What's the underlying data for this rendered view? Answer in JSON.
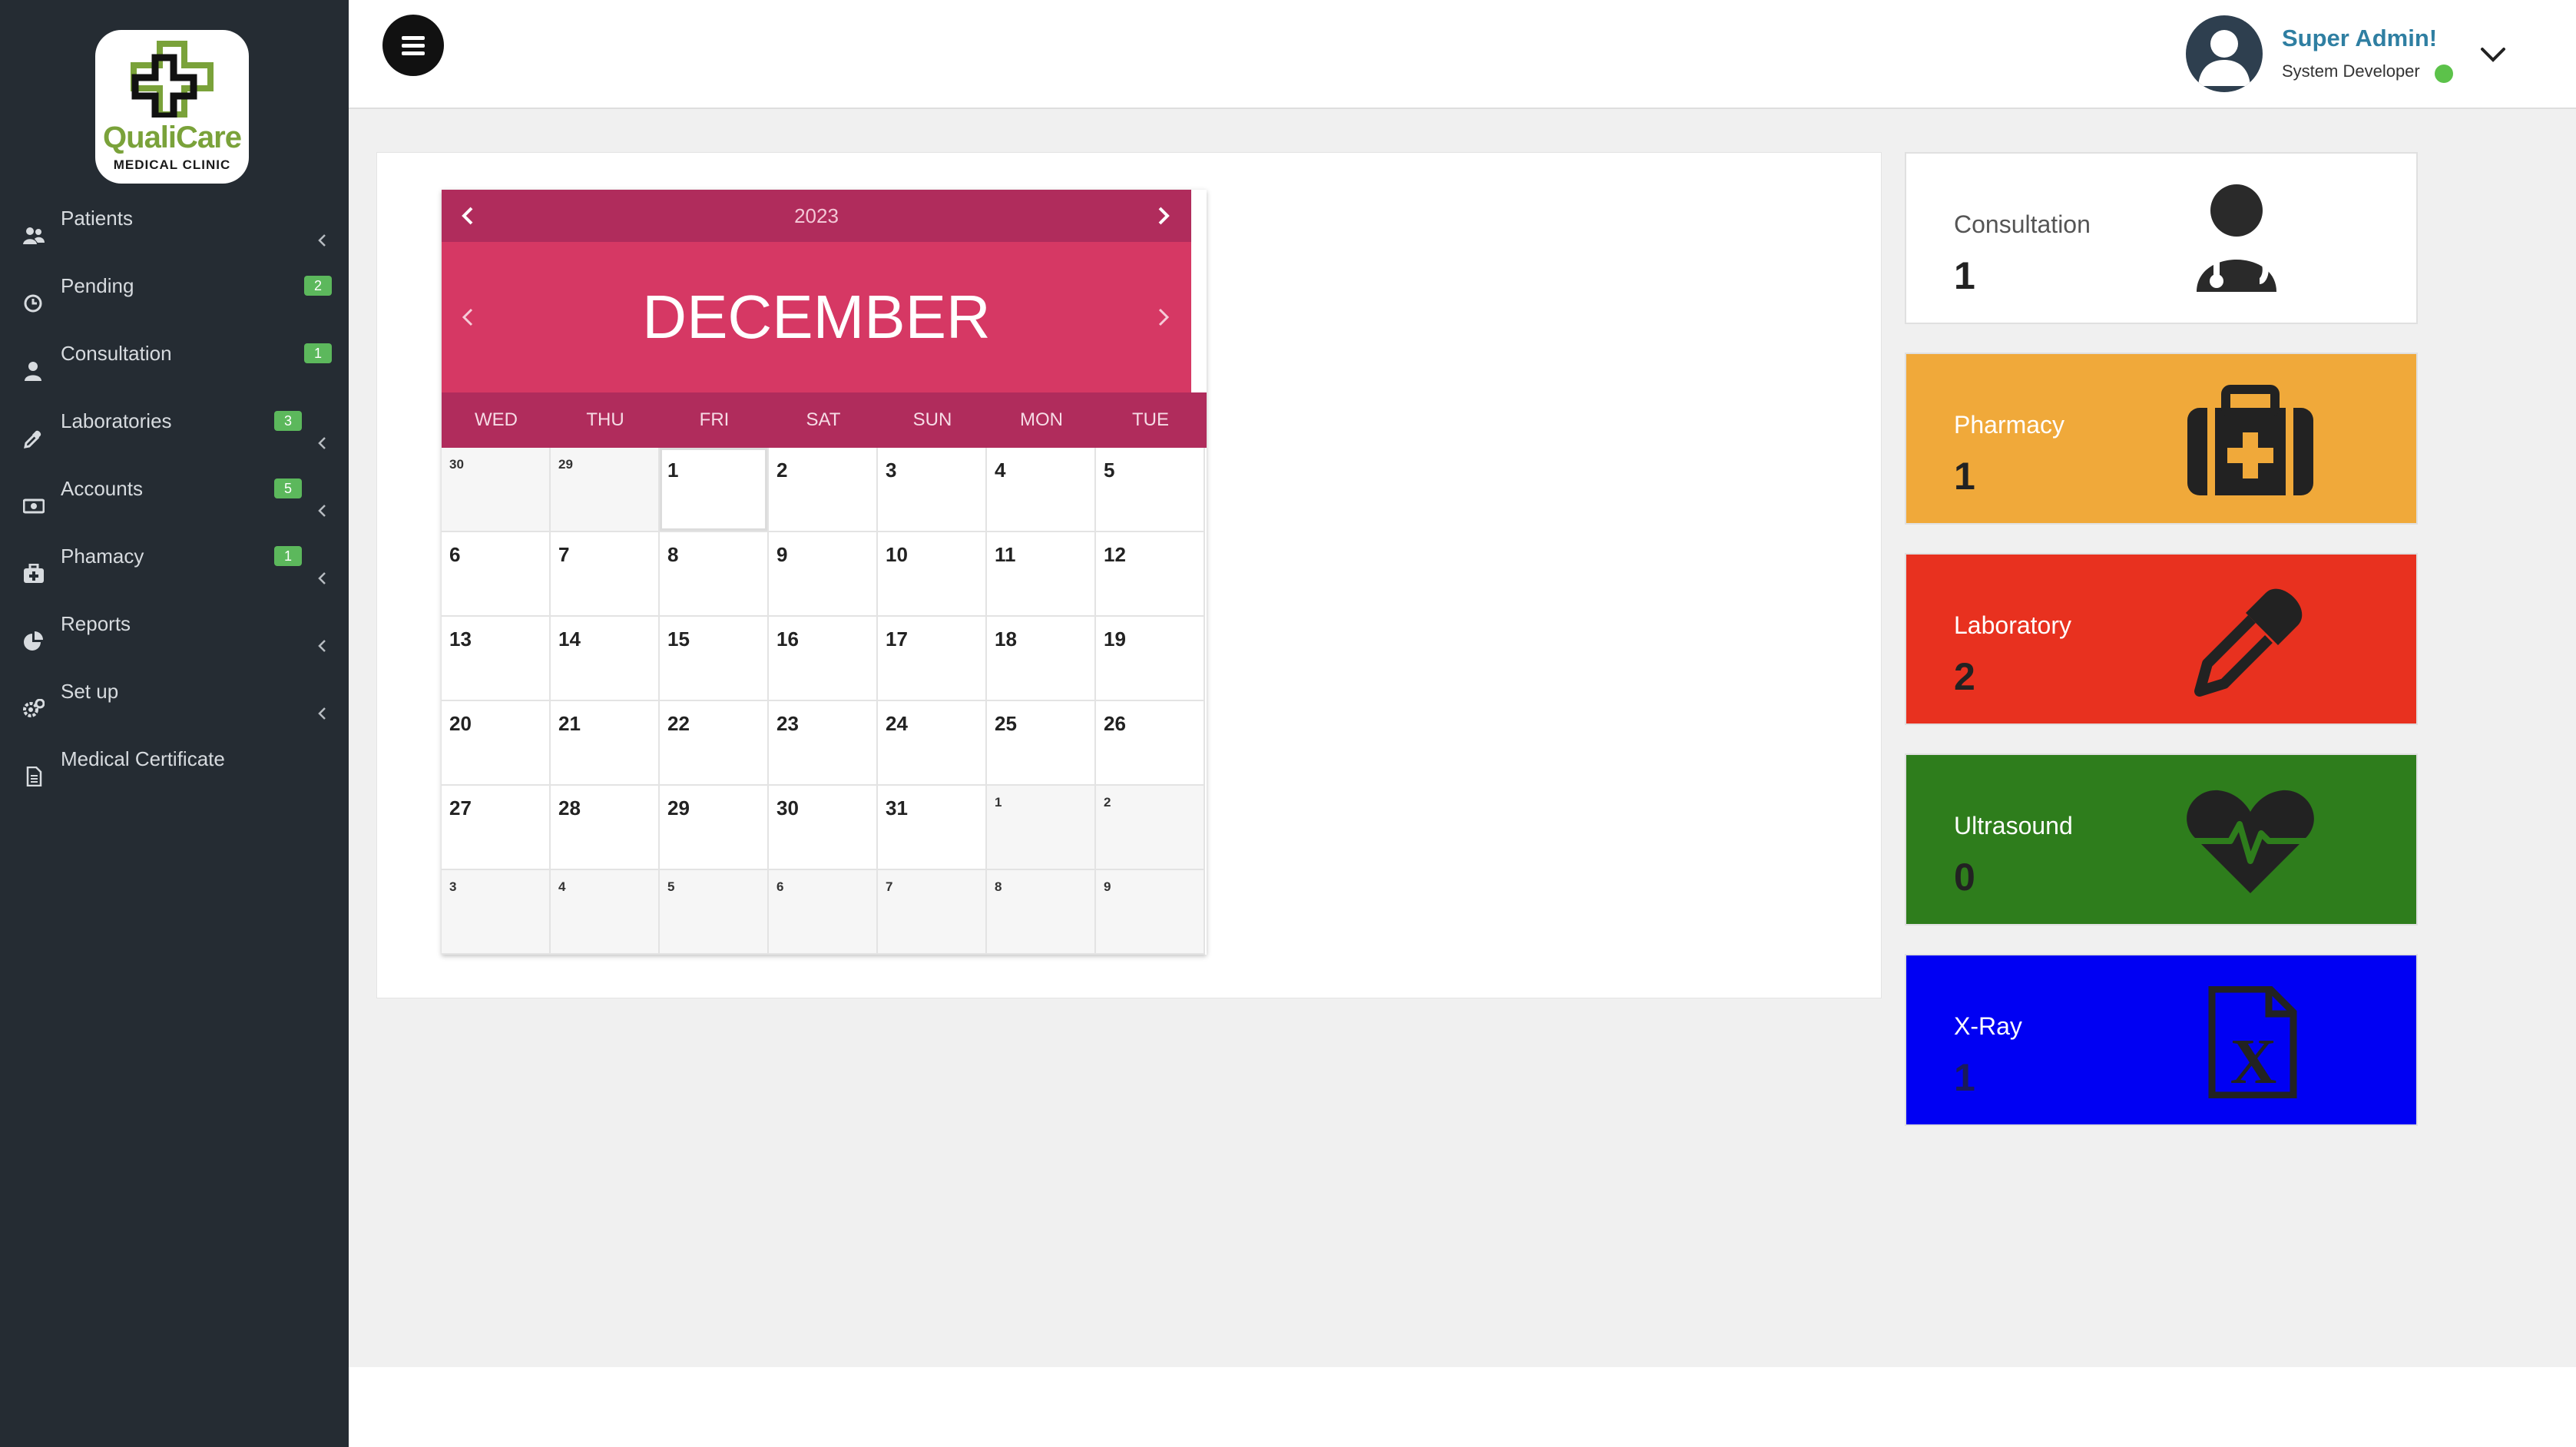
{
  "brand": {
    "logo_name": "QualiCare",
    "logo_sub": "MEDICAL CLINIC"
  },
  "sidebar": {
    "items": [
      {
        "label": "Patients",
        "icon": "users-icon",
        "badge": "",
        "has_chevron": true
      },
      {
        "label": "Pending",
        "icon": "clock-icon",
        "badge": "2",
        "has_chevron": false
      },
      {
        "label": "Consultation",
        "icon": "user-doctor-icon",
        "badge": "1",
        "has_chevron": false
      },
      {
        "label": "Laboratories",
        "icon": "eyedropper-icon",
        "badge": "3",
        "has_chevron": true
      },
      {
        "label": "Accounts",
        "icon": "money-bill-icon",
        "badge": "5",
        "has_chevron": true
      },
      {
        "label": "Phamacy",
        "icon": "medkit-icon",
        "badge": "1",
        "has_chevron": true
      },
      {
        "label": "Reports",
        "icon": "pie-chart-icon",
        "badge": "",
        "has_chevron": true
      },
      {
        "label": "Set up",
        "icon": "gears-icon",
        "badge": "",
        "has_chevron": true
      },
      {
        "label": "Medical Certificate",
        "icon": "file-text-icon",
        "badge": "",
        "has_chevron": false
      }
    ]
  },
  "header": {
    "menu_icon": "hamburger-icon",
    "user_name": "Super Admin!",
    "user_role": "System Developer",
    "status_color": "#5cc24a"
  },
  "calendar": {
    "year": "2023",
    "month": "DECEMBER",
    "day_names": [
      "WED",
      "THU",
      "FRI",
      "SAT",
      "SUN",
      "MON",
      "TUE"
    ],
    "weeks": [
      [
        {
          "d": "30",
          "other": true
        },
        {
          "d": "29",
          "other": true
        },
        {
          "d": "1",
          "today": true
        },
        {
          "d": "2"
        },
        {
          "d": "3"
        },
        {
          "d": "4"
        },
        {
          "d": "5"
        }
      ],
      [
        {
          "d": "6"
        },
        {
          "d": "7"
        },
        {
          "d": "8"
        },
        {
          "d": "9"
        },
        {
          "d": "10"
        },
        {
          "d": "11"
        },
        {
          "d": "12"
        }
      ],
      [
        {
          "d": "13"
        },
        {
          "d": "14"
        },
        {
          "d": "15"
        },
        {
          "d": "16"
        },
        {
          "d": "17"
        },
        {
          "d": "18"
        },
        {
          "d": "19"
        }
      ],
      [
        {
          "d": "20"
        },
        {
          "d": "21"
        },
        {
          "d": "22"
        },
        {
          "d": "23"
        },
        {
          "d": "24"
        },
        {
          "d": "25"
        },
        {
          "d": "26"
        }
      ],
      [
        {
          "d": "27"
        },
        {
          "d": "28"
        },
        {
          "d": "29"
        },
        {
          "d": "30"
        },
        {
          "d": "31"
        },
        {
          "d": "1",
          "other": true
        },
        {
          "d": "2",
          "other": true
        }
      ],
      [
        {
          "d": "3",
          "other": true
        },
        {
          "d": "4",
          "other": true
        },
        {
          "d": "5",
          "other": true
        },
        {
          "d": "6",
          "other": true
        },
        {
          "d": "7",
          "other": true
        },
        {
          "d": "8",
          "other": true
        },
        {
          "d": "9",
          "other": true
        }
      ]
    ],
    "colors": {
      "header": "#b02c5c",
      "month": "#d63864"
    }
  },
  "cards": [
    {
      "title": "Consultation",
      "value": "1",
      "icon": "user-doctor-icon",
      "bg": "#ffffff",
      "color": "#555555",
      "value_color": "#222222"
    },
    {
      "title": "Pharmacy",
      "value": "1",
      "icon": "medkit-icon",
      "bg": "#f0a93a",
      "color": "#ffffff",
      "value_color": "#222222"
    },
    {
      "title": "Laboratory",
      "value": "2",
      "icon": "eyedropper-icon",
      "bg": "#e8311f",
      "color": "#ffffff",
      "value_color": "#222222"
    },
    {
      "title": "Ultrasound",
      "value": "0",
      "icon": "heartbeat-icon",
      "bg": "#2e7d1c",
      "color": "#ffffff",
      "value_color": "#222222"
    },
    {
      "title": "X-Ray",
      "value": "1",
      "icon": "file-excel-icon",
      "bg": "#0000f3",
      "color": "#ffffff",
      "value_color": "#1a1a5a"
    }
  ]
}
